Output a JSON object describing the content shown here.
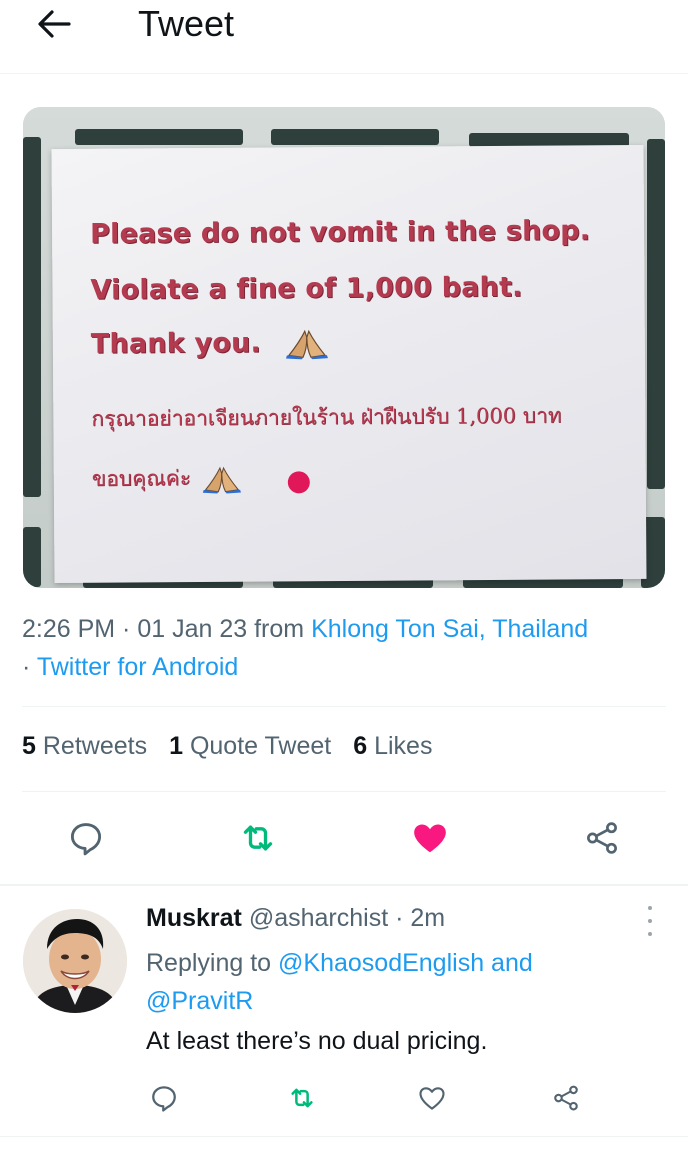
{
  "header": {
    "title": "Tweet",
    "back_icon": "arrow-left-icon"
  },
  "media": {
    "sign_lines": [
      "Please do not vomit in the shop.",
      "Violate a fine of 1,000 baht.",
      "Thank you."
    ],
    "sign_thai_lines": [
      "กรุณาอย่าอาเจียนภายในร้าน ฝ่าฝืนปรับ 1,000 บาท",
      "ขอบคุณค่ะ"
    ],
    "sign_color": "#b43a50"
  },
  "tweet_meta": {
    "time": "2:26 PM",
    "sep1": " · ",
    "date": "01 Jan 23",
    "from_label": " from ",
    "location": "Khlong Ton Sai, Thailand",
    "sep2": "· ",
    "client": "Twitter for Android"
  },
  "stats": {
    "retweets_count": "5",
    "retweets_label": "Retweets",
    "quotes_count": "1",
    "quotes_label": "Quote Tweet",
    "likes_count": "6",
    "likes_label": "Likes"
  },
  "actions": {
    "reply_icon": "reply-icon",
    "retweet_icon": "retweet-icon",
    "like_icon": "heart-filled-icon",
    "share_icon": "share-icon",
    "like_color": "#f91880",
    "retweet_color": "#00ba7c"
  },
  "reply": {
    "name": "Muskrat",
    "handle": "@asharchist",
    "sep": " · ",
    "time": "2m",
    "replying_to_label": "Replying to ",
    "mention1": "@KhaosodEnglish",
    "and_label": " and",
    "mention2": "@PravitR",
    "text": "At least there’s no dual pricing."
  },
  "colors": {
    "link": "#1d9bf0",
    "secondary_text": "#536471",
    "primary_text": "#0f1419"
  }
}
